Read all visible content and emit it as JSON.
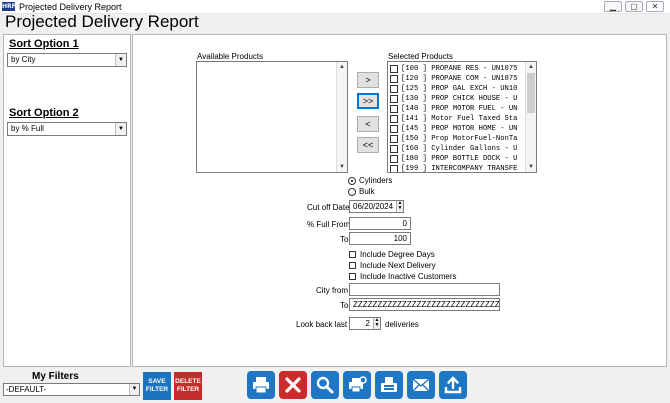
{
  "window": {
    "app_icon_text": "HRF",
    "title": "Projected Delivery Report",
    "controls": [
      "▁",
      "▢",
      "✕"
    ]
  },
  "page_title": "Projected Delivery Report",
  "sort_option_1": {
    "label": "Sort Option 1",
    "value": "by City"
  },
  "sort_option_2": {
    "label": "Sort Option 2",
    "value": "by % Full"
  },
  "available_products": {
    "label": "Available Products",
    "items": []
  },
  "selected_products": {
    "label": "Selected Products",
    "items": [
      "[100  ] PROPANE RES - UN1075",
      "[120  ] PROPANE COM - UN1075",
      "[125  ] PROP GAL EXCH - UN10",
      "[130  ] PROP CHICK HOUSE - U",
      "[140  ] PROP MOTOR FUEL - UN",
      "[141  ] Motor Fuel Taxed Sta",
      "[145  ] PROP MOTOR HOME - UN",
      "[150  ] Prop MotorFuel-NonTa",
      "[160  ] Cylinder Gallons - U",
      "[180  ] PROP BOTTLE DOCK - U",
      "[199  ] INTERCOMPANY TRANSFE"
    ]
  },
  "move_buttons": {
    "add": ">",
    "add_all": ">>",
    "remove": "<",
    "remove_all": "<<"
  },
  "type_options": {
    "cylinders": "Cylinders",
    "bulk": "Bulk",
    "selected": "cylinders"
  },
  "cutoff_date": {
    "label": "Cut off Date",
    "value": "06/20/2024"
  },
  "pct_full_from": {
    "label": "% Full From",
    "value": "0"
  },
  "pct_full_to": {
    "label": "To",
    "value": "100"
  },
  "checkboxes": {
    "degree_days": {
      "label": "Include Degree Days",
      "checked": false
    },
    "next_delivery": {
      "label": "Include Next Delivery",
      "checked": false
    },
    "inactive_customers": {
      "label": "Include Inactive Customers",
      "checked": false
    }
  },
  "city_from": {
    "label": "City from",
    "value": ""
  },
  "city_to": {
    "label": "To",
    "value": "ZZZZZZZZZZZZZZZZZZZZZZZZZZZZZZ"
  },
  "look_back": {
    "label": "Look back last",
    "value": "2",
    "suffix": "deliveries"
  },
  "my_filters": {
    "title": "My Filters",
    "selected": "-DEFAULT-"
  },
  "filter_buttons": {
    "save_line1": "SAVE",
    "save_line2": "FILTER",
    "delete_line1": "DELETE",
    "delete_line2": "FILTER"
  },
  "toolbar": {
    "icons": [
      "printer-icon",
      "close-icon",
      "search-icon",
      "print-preview-icon",
      "fax-icon",
      "email-icon",
      "export-icon"
    ],
    "colors": {
      "blue": "#1f76c5",
      "red": "#cc2b2b"
    }
  }
}
